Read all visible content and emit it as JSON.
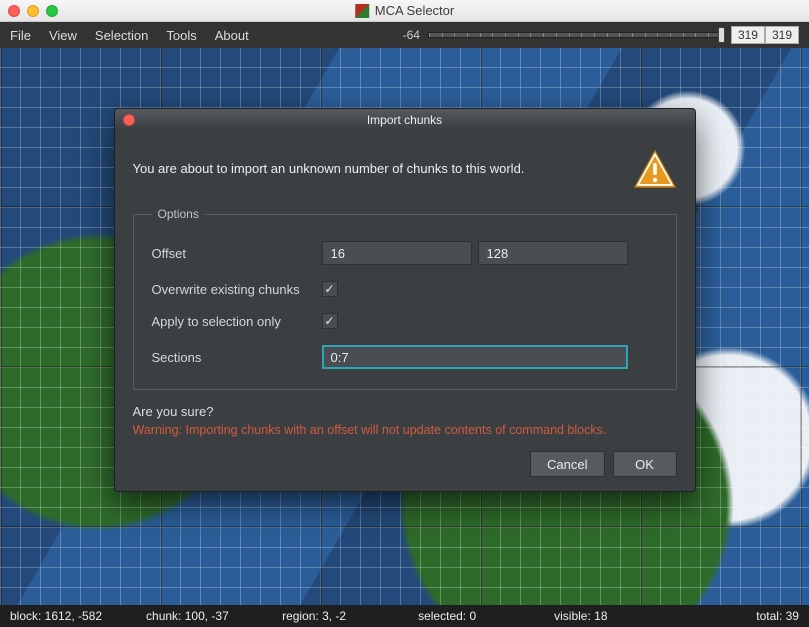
{
  "app": {
    "title": "MCA Selector"
  },
  "menubar": {
    "items": [
      "File",
      "View",
      "Selection",
      "Tools",
      "About"
    ]
  },
  "slider": {
    "left_label": "-64",
    "right_val_a": "319",
    "right_val_b": "319"
  },
  "statusbar": {
    "block": "block: 1612, -582",
    "chunk": "chunk: 100, -37",
    "region": "region: 3, -2",
    "selected": "selected: 0",
    "visible": "visible: 18",
    "total": "total: 39"
  },
  "modal": {
    "title": "Import chunks",
    "headline": "You are about to import an unknown number of chunks to this world.",
    "options_legend": "Options",
    "offset_label": "Offset",
    "offset_x": "16",
    "offset_z": "128",
    "overwrite_label": "Overwrite existing chunks",
    "overwrite_checked": true,
    "selection_only_label": "Apply to selection only",
    "selection_only_checked": true,
    "sections_label": "Sections",
    "sections_value": "0:7",
    "confirm_question": "Are you sure?",
    "warning": "Warning: Importing chunks with an offset will not update contents of command blocks.",
    "cancel": "Cancel",
    "ok": "OK"
  }
}
